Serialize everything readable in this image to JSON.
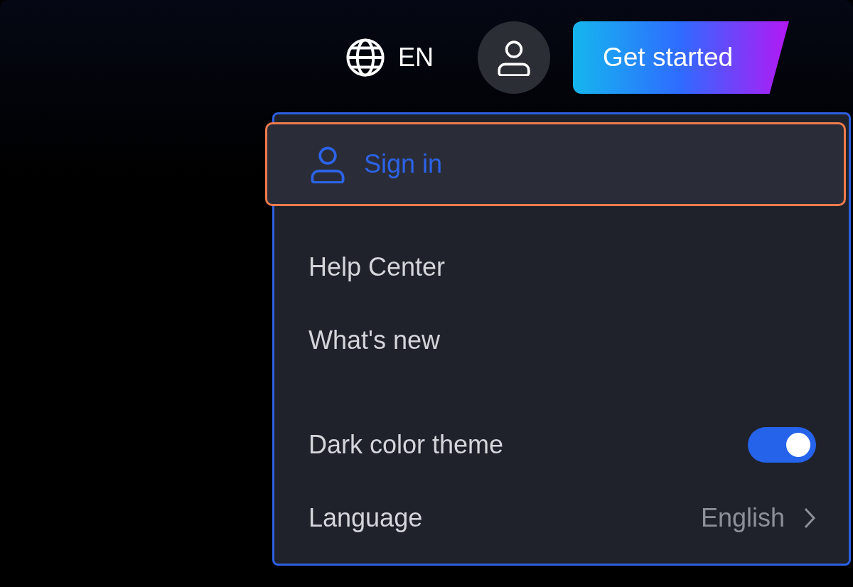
{
  "header": {
    "language": "EN",
    "cta": "Get started"
  },
  "menu": {
    "sections": [
      [
        {
          "kind": "account",
          "label": "Sign in",
          "selected": true
        }
      ],
      [
        {
          "kind": "link",
          "label": "Help Center",
          "selected": false
        },
        {
          "kind": "link",
          "label": "What's new",
          "selected": false
        }
      ],
      [
        {
          "kind": "toggle",
          "label": "Dark color theme",
          "on": true,
          "selected": false
        },
        {
          "kind": "select",
          "label": "Language",
          "value": "English",
          "selected": false
        }
      ]
    ]
  }
}
